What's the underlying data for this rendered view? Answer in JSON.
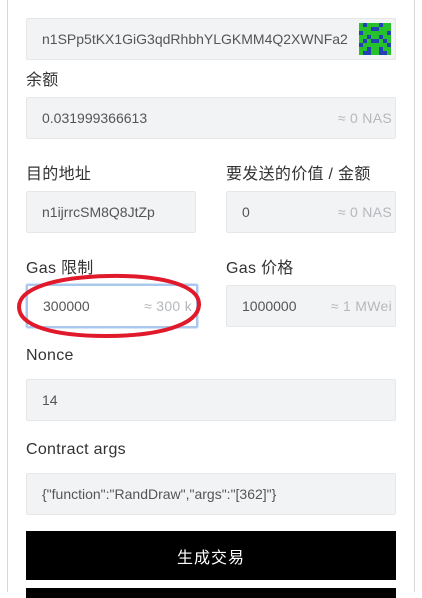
{
  "from_address": {
    "value": "n1SPp5tKX1GiG3qdRhbhYLGKMM4Q2XWNFa2",
    "avatar": "identicon-icon"
  },
  "balance": {
    "label": "余额",
    "value": "0.031999366613",
    "approx": "≈ 0 NAS"
  },
  "to_address": {
    "label": "目的地址",
    "value": "n1ijrrcSM8Q8JtZp"
  },
  "amount": {
    "label": "要发送的价值 / 金额",
    "value": "0",
    "approx": "≈ 0 NAS"
  },
  "gas_limit": {
    "label": "Gas 限制",
    "value": "300000",
    "approx": "≈ 300 k"
  },
  "gas_price": {
    "label": "Gas 价格",
    "value": "1000000",
    "approx": "≈ 1 MWei"
  },
  "nonce": {
    "label": "Nonce",
    "value": "14"
  },
  "contract_args": {
    "label": "Contract args",
    "value": "{\"function\":\"RandDraw\",\"args\":\"[362]\"}"
  },
  "generate_button": {
    "label": "生成交易"
  },
  "colors": {
    "annotation": "#e0192b",
    "button": "#000000",
    "focus_border": "#a9c8ee",
    "field_bg": "#f2f3f4"
  }
}
